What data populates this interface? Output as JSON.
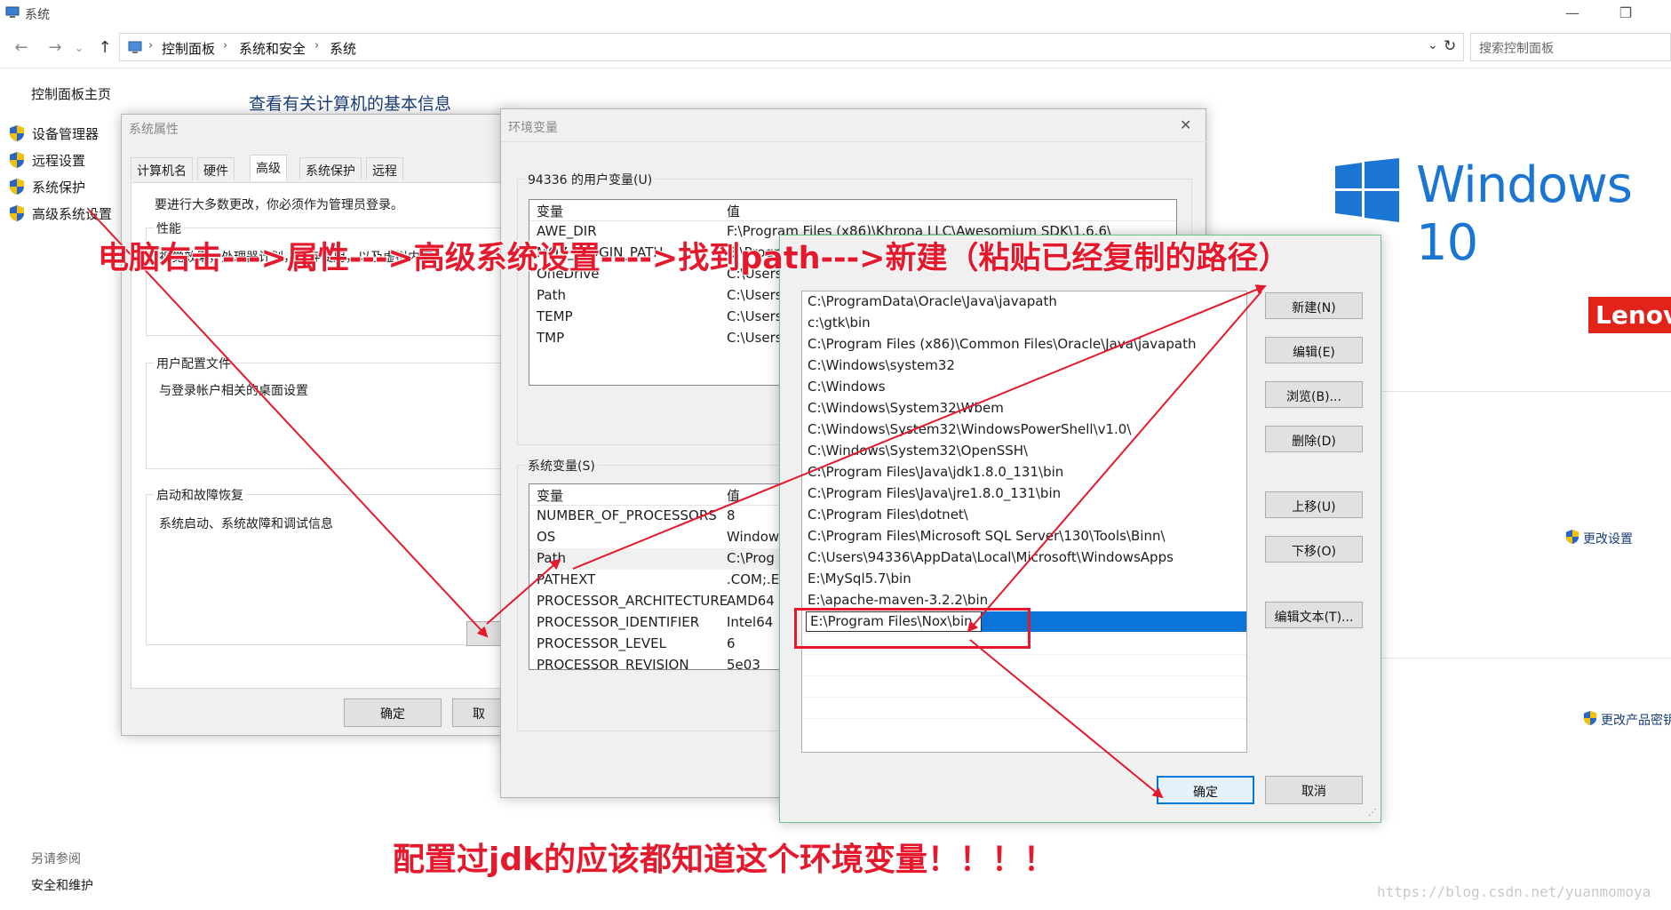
{
  "window": {
    "title": "系统",
    "minimize": "—",
    "restore": "❐"
  },
  "address": {
    "crumbs": [
      "控制面板",
      "系统和安全",
      "系统"
    ],
    "search_placeholder": "搜索控制面板"
  },
  "sidebar": {
    "home": "控制面板主页",
    "items": [
      "设备管理器",
      "远程设置",
      "系统保护",
      "高级系统设置"
    ],
    "see_also_title": "另请参阅",
    "see_also_items": [
      "安全和维护"
    ]
  },
  "main": {
    "heading": "查看有关计算机的基本信息",
    "windows_brand": "Windows 10",
    "oem_brand": "Lenovo",
    "change_settings": "更改设置",
    "change_product_key": "更改产品密钥"
  },
  "sysprops": {
    "title": "系统属性",
    "tabs": [
      "计算机名",
      "硬件",
      "高级",
      "系统保护",
      "远程"
    ],
    "admin_note": "要进行大多数更改，你必须作为管理员登录。",
    "perf_title": "性能",
    "perf_desc": "视觉效果，处理器计划，内存使用，以及虚拟内存",
    "profile_title": "用户配置文件",
    "profile_desc": "与登录帐户相关的桌面设置",
    "startup_title": "启动和故障恢复",
    "startup_desc": "系统启动、系统故障和调试信息",
    "ok": "确定",
    "cancel": "取"
  },
  "envvars": {
    "title": "环境变量",
    "close": "✕",
    "user_group": "94336 的用户变量(U)",
    "col_var": "变量",
    "col_val": "值",
    "user_vars": [
      {
        "name": "AWE_DIR",
        "value": "F:\\Program Files (x86)\\Khrona LLC\\Awesomium SDK\\1.6.6\\"
      },
      {
        "name": "MOZ_PLUGIN_PATH",
        "value": "E:\\Program Files (x86)\\Foxit Software\\"
      },
      {
        "name": "OneDrive",
        "value": "C:\\Users"
      },
      {
        "name": "Path",
        "value": "C:\\Users"
      },
      {
        "name": "TEMP",
        "value": "C:\\Users"
      },
      {
        "name": "TMP",
        "value": "C:\\Users"
      }
    ],
    "sys_group": "系统变量(S)",
    "sys_vars": [
      {
        "name": "NUMBER_OF_PROCESSORS",
        "value": "8"
      },
      {
        "name": "OS",
        "value": "Window"
      },
      {
        "name": "Path",
        "value": "C:\\Prog"
      },
      {
        "name": "PATHEXT",
        "value": ".COM;.E"
      },
      {
        "name": "PROCESSOR_ARCHITECTURE",
        "value": "AMD64"
      },
      {
        "name": "PROCESSOR_IDENTIFIER",
        "value": "Intel64"
      },
      {
        "name": "PROCESSOR_LEVEL",
        "value": "6"
      },
      {
        "name": "PROCESSOR_REVISION",
        "value": "5e03"
      }
    ]
  },
  "editenv": {
    "paths": [
      "C:\\ProgramData\\Oracle\\Java\\javapath",
      "c:\\gtk\\bin",
      "C:\\Program Files (x86)\\Common Files\\Oracle\\Java\\javapath",
      "C:\\Windows\\system32",
      "C:\\Windows",
      "C:\\Windows\\System32\\Wbem",
      "C:\\Windows\\System32\\WindowsPowerShell\\v1.0\\",
      "C:\\Windows\\System32\\OpenSSH\\",
      "C:\\Program Files\\Java\\jdk1.8.0_131\\bin",
      "C:\\Program Files\\Java\\jre1.8.0_131\\bin",
      "C:\\Program Files\\dotnet\\",
      "C:\\Program Files\\Microsoft SQL Server\\130\\Tools\\Binn\\",
      "C:\\Users\\94336\\AppData\\Local\\Microsoft\\WindowsApps",
      "E:\\MySql5.7\\bin",
      "E:\\apache-maven-3.2.2\\bin"
    ],
    "editing_value": "E:\\Program Files\\Nox\\bin",
    "buttons": {
      "new": "新建(N)",
      "edit": "编辑(E)",
      "browse": "浏览(B)...",
      "delete": "删除(D)",
      "move_up": "上移(U)",
      "move_down": "下移(O)",
      "edit_text": "编辑文本(T)...",
      "ok": "确定",
      "cancel": "取消"
    }
  },
  "annotations": {
    "top": "电脑右击--->属性--->高级系统设置---->找到path--->新建（粘贴已经复制的路径）",
    "bottom": "配置过jdk的应该都知道这个环境变量！！！！",
    "watermark": "https://blog.csdn.net/yuanmomoya"
  },
  "colors": {
    "accent": "#0078d7",
    "annotation": "#e5182c",
    "heading": "#1a3e7a"
  }
}
